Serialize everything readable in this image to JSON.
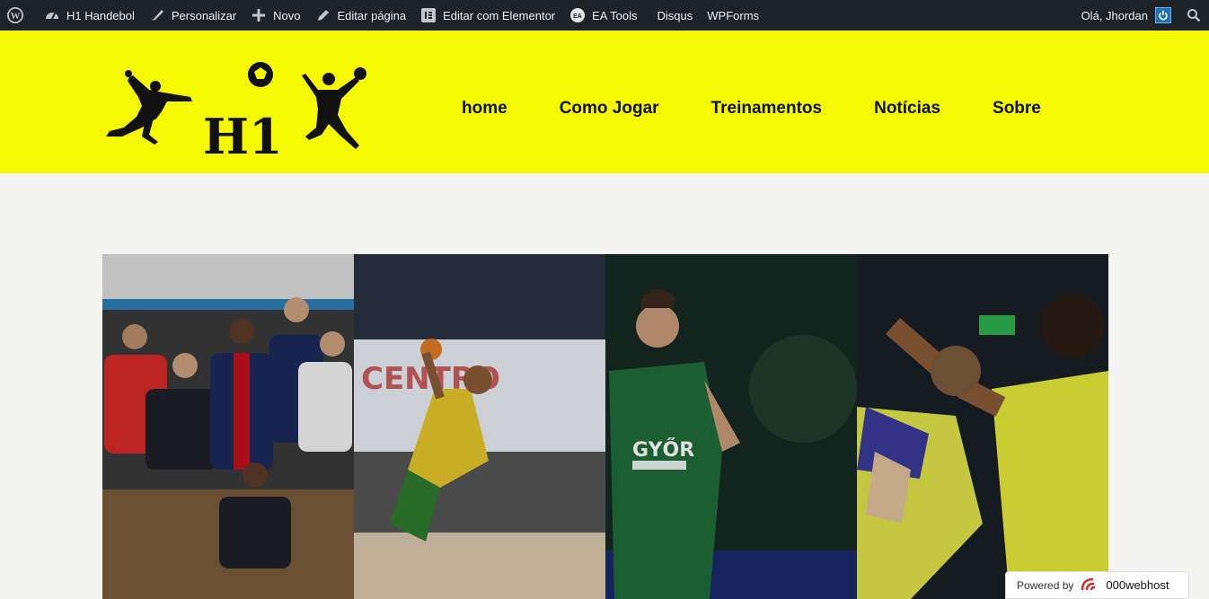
{
  "adminbar": {
    "site_name": "H1 Handebol",
    "customize": "Personalizar",
    "new": "Novo",
    "edit_page": "Editar página",
    "edit_elementor": "Editar com Elementor",
    "ea_tools": "EA Tools",
    "disqus": "Disqus",
    "wpforms": "WPForms",
    "greeting": "Olá, Jhordan"
  },
  "logo": {
    "text": "H1"
  },
  "nav": {
    "items": [
      "home",
      "Como Jogar",
      "Treinamentos",
      "Notícias",
      "Sobre"
    ]
  },
  "footer_badge": {
    "label": "Powered by",
    "brand": "000webhost"
  }
}
